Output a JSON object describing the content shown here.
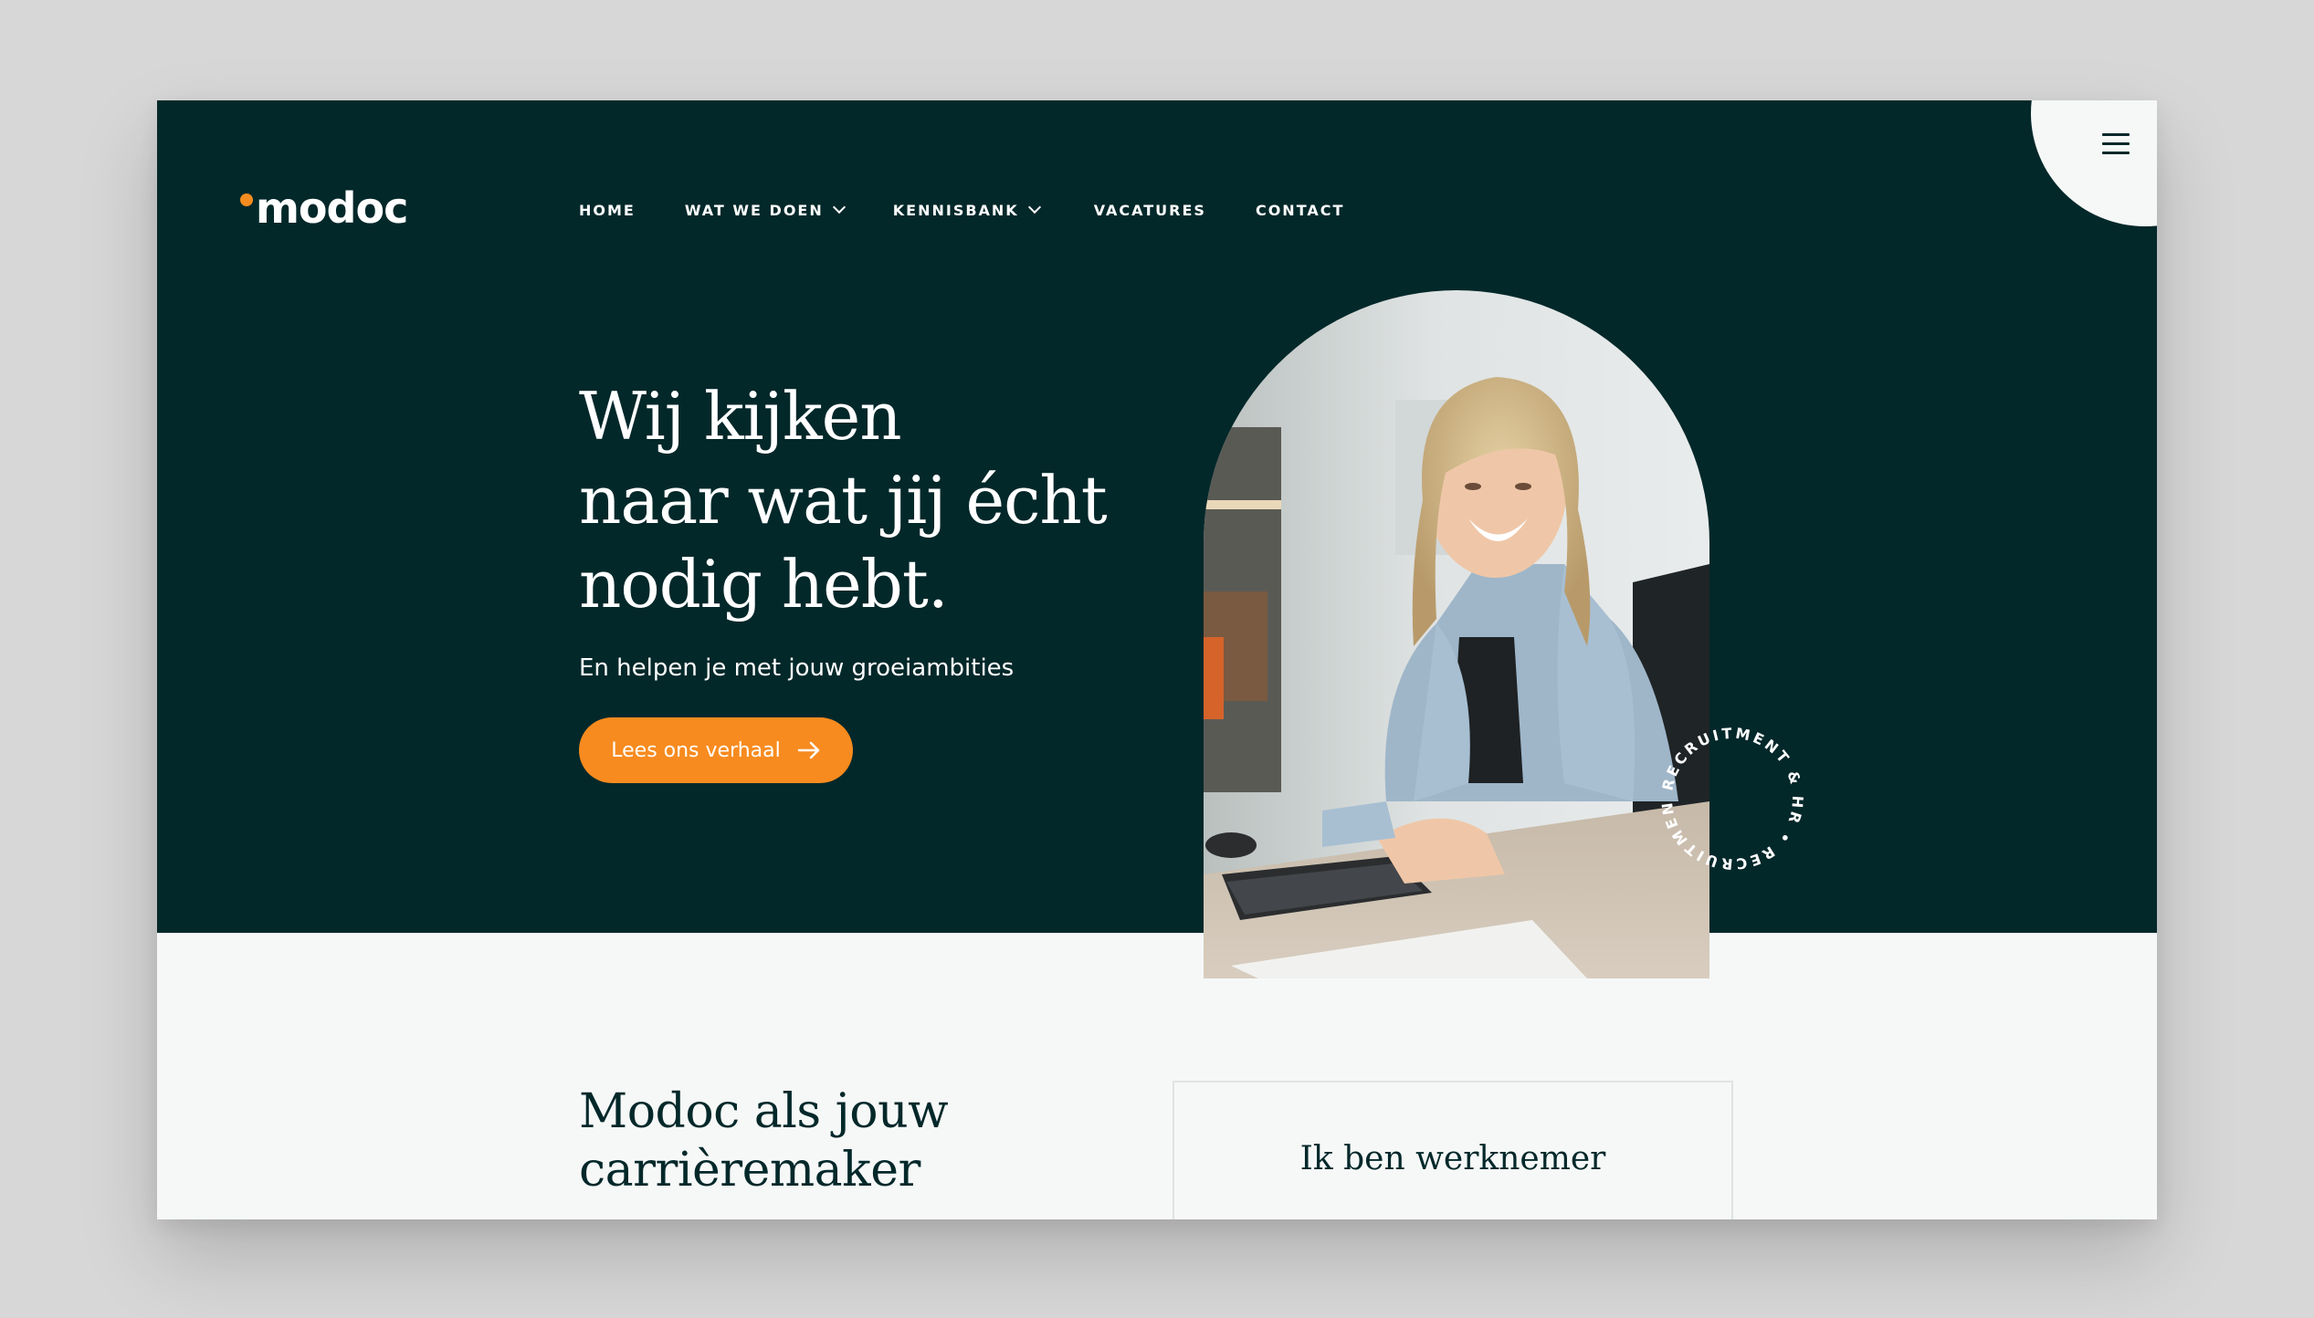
{
  "brand": {
    "name": "modoc",
    "accent_color": "#f58c1f",
    "dark_color": "#03282a"
  },
  "nav": {
    "items": [
      {
        "label": "HOME",
        "has_dropdown": false
      },
      {
        "label": "WAT WE DOEN",
        "has_dropdown": true
      },
      {
        "label": "KENNISBANK",
        "has_dropdown": true
      },
      {
        "label": "VACATURES",
        "has_dropdown": false
      },
      {
        "label": "CONTACT",
        "has_dropdown": false
      }
    ],
    "menu_icon": "hamburger-menu-icon"
  },
  "hero": {
    "title_lines": [
      "Wij kijken",
      "naar wat jij écht",
      "nodig hebt."
    ],
    "subtitle": "En helpen je met jouw groeiambities",
    "cta_label": "Lees ons verhaal",
    "cta_icon": "arrow-right-icon",
    "badge_text": "RECRUITMENT & HR • RECRUITMENT & HR •"
  },
  "intro": {
    "title_lines": [
      "Modoc als jouw",
      "carrièremaker"
    ],
    "card_title": "Ik ben werknemer"
  }
}
